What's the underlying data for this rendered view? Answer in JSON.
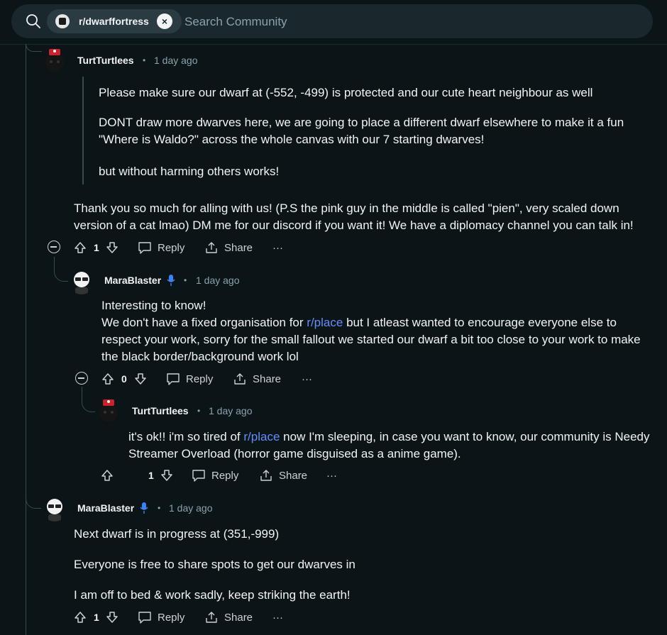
{
  "search": {
    "community": "r/dwarffortress",
    "placeholder": "Search Community"
  },
  "comments": [
    {
      "author": "TurtTurtlees",
      "time": "1 day ago",
      "quote": [
        "Please make sure our dwarf at (-552, -499) is protected and our cute heart neighbour as well",
        "DONT draw more dwarves here, we are going to place a different dwarf elsewhere to make it a fun",
        "\"Where is Waldo?\" across the whole canvas with our 7 starting dwarves!",
        "but without harming others works!"
      ],
      "body": [
        "Thank you so much for alling with us! (P.S the pink guy in the middle is called \"pien\", very scaled down",
        "version of a cat lmao) DM me for our discord if you want it! We have a diplomacy channel you can talk in!"
      ],
      "votes": "1",
      "reply": "Reply",
      "share": "Share"
    },
    {
      "author": "MaraBlaster",
      "time": "1 day ago",
      "body": [
        "Interesting to know!",
        "We don't have a fixed organisation for",
        "r/place",
        "but I atleast wanted to encourage everyone else to",
        "respect your work, sorry for the small fallout we started our dwarf a bit too close to your work to make",
        "the black border/background work lol"
      ],
      "votes": "0",
      "reply": "Reply",
      "share": "Share"
    },
    {
      "author": "TurtTurtlees",
      "time": "1 day ago",
      "body": [
        "it's ok!! i'm so tired of",
        "r/place",
        "now I'm sleeping, in case you want to know, our community is Needy",
        "Streamer Overload (horror game disguised as a anime game)."
      ],
      "votes": "1",
      "reply": "Reply",
      "share": "Share"
    },
    {
      "author": "MaraBlaster",
      "time": "1 day ago",
      "body": [
        "Next dwarf is in progress at (351,-999)",
        "Everyone is free to share spots to get our dwarves in",
        "I am off to bed & work sadly, keep striking the earth!"
      ],
      "votes": "1",
      "reply": "Reply",
      "share": "Share"
    }
  ],
  "separator": "•",
  "colors": {
    "background": "#0b1416",
    "link": "#648efc",
    "mic": "#3b82f6",
    "threadline": "#3a4a50"
  }
}
